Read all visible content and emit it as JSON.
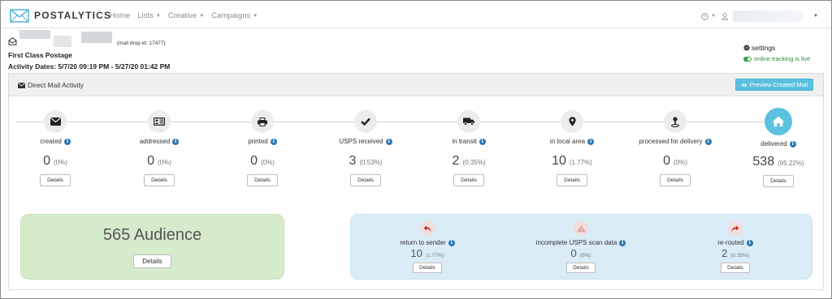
{
  "navbar": {
    "brand": "POSTALYTICS",
    "links": [
      {
        "label": "Home",
        "dropdown": false
      },
      {
        "label": "Lists",
        "dropdown": true
      },
      {
        "label": "Creative",
        "dropdown": true
      },
      {
        "label": "Campaigns",
        "dropdown": true
      }
    ],
    "help_icon": "question-circle-icon",
    "user_icon": "user-icon"
  },
  "drop": {
    "drop_id": "(mail drop id: 17477)",
    "postage": "First Class Postage",
    "dates": "Activity Dates: 5/7/20 09:19 PM - 5/27/20 01:42 PM",
    "settings_label": "settings",
    "tracking_label": "online tracking is live"
  },
  "panel": {
    "title": "Direct Mail Activity",
    "preview_button": "Preview Created Mail"
  },
  "stages": [
    {
      "icon": "envelope-icon",
      "label": "created",
      "count": "0",
      "pct": "(0%)",
      "details": "Details",
      "active": false
    },
    {
      "icon": "address-card-icon",
      "label": "addressed",
      "count": "0",
      "pct": "(0%)",
      "details": "Details",
      "active": false
    },
    {
      "icon": "printer-icon",
      "label": "printed",
      "count": "0",
      "pct": "(0%)",
      "details": "Details",
      "active": false
    },
    {
      "icon": "checkmark-icon",
      "label": "USPS received",
      "count": "3",
      "pct": "(0.53%)",
      "details": "Details",
      "active": false
    },
    {
      "icon": "truck-icon",
      "label": "in transit",
      "count": "2",
      "pct": "(0.35%)",
      "details": "Details",
      "active": false
    },
    {
      "icon": "map-pin-icon",
      "label": "in local area",
      "count": "10",
      "pct": "(1.77%)",
      "details": "Details",
      "active": false
    },
    {
      "icon": "map-marker-down-icon",
      "label": "processed for delivery",
      "count": "0",
      "pct": "(0%)",
      "details": "Details",
      "active": false
    },
    {
      "icon": "home-icon",
      "label": "delivered",
      "count": "538",
      "pct": "(95.22%)",
      "details": "Details",
      "active": true
    }
  ],
  "audience": {
    "text": "565 Audience",
    "details": "Details"
  },
  "exceptions": [
    {
      "icon": "return-arrow-icon",
      "label": "return to sender",
      "count": "10",
      "pct": "(1.77%)",
      "details": "Details"
    },
    {
      "icon": "warning-icon",
      "label": "incomplete USPS scan data",
      "count": "0",
      "pct": "(0%)",
      "details": "Details"
    },
    {
      "icon": "forward-arrow-icon",
      "label": "re-routed",
      "count": "2",
      "pct": "(0.35%)",
      "details": "Details"
    }
  ],
  "colors": {
    "accent": "#5bc0de",
    "info": "#2b79b6",
    "live_green": "#3aa14a",
    "audience_bg": "#d6ebcc",
    "exceptions_bg": "#daecf6"
  }
}
